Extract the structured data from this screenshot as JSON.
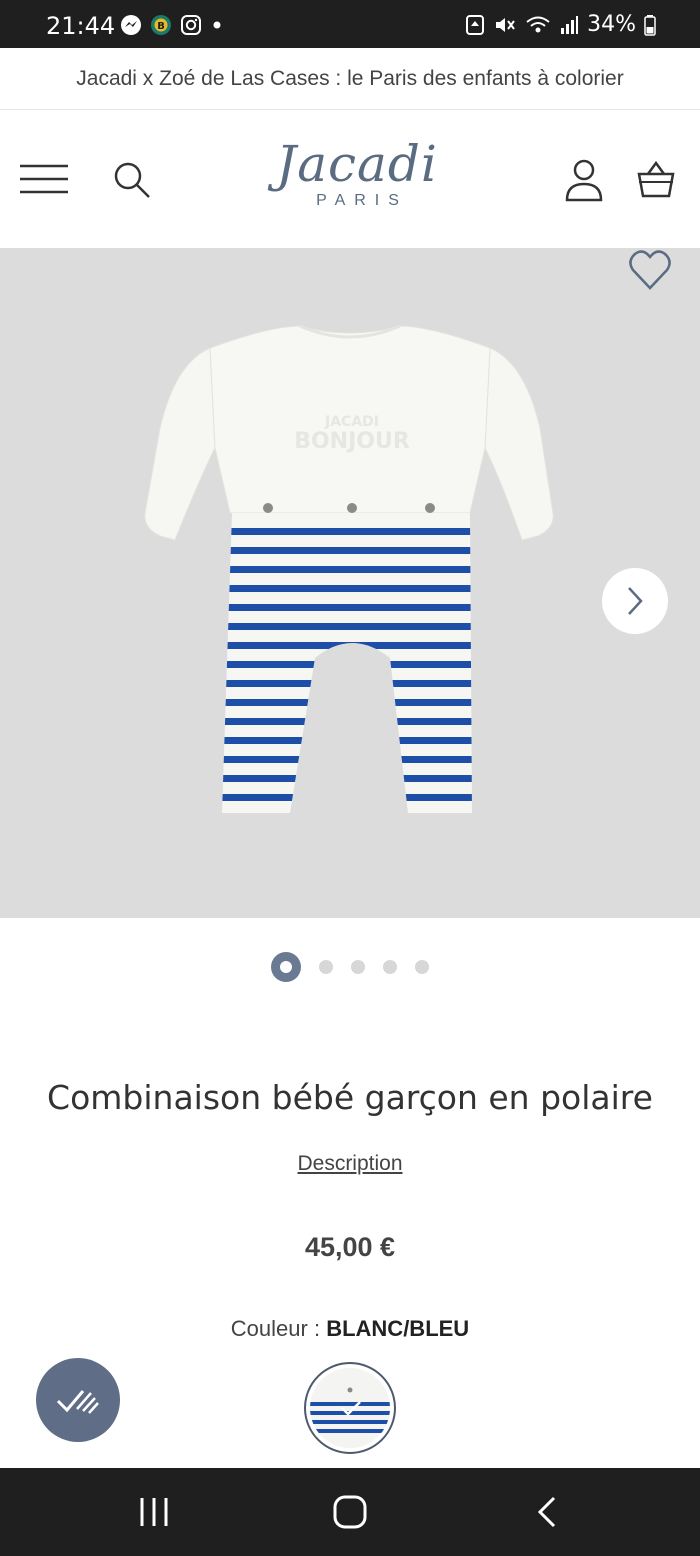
{
  "status_bar": {
    "time": "21:44",
    "battery": "34%",
    "left_icons": [
      "messenger-icon",
      "app-badge-icon",
      "instagram-icon",
      "dot-icon"
    ],
    "right_icons": [
      "recycle-icon",
      "mute-icon",
      "wifi-icon",
      "signal-icon",
      "battery-icon"
    ]
  },
  "promo": {
    "text": "Jacadi x Zoé de Las Cases : le Paris des enfants à colorier"
  },
  "header": {
    "logo_script": "Jacadi",
    "logo_sub": "PARIS",
    "brand_color": "#5a6b82"
  },
  "gallery": {
    "background": "#dcdcdd",
    "embroidery_line1": "JACADI",
    "embroidery_line2": "BONJOUR",
    "total_images": 5,
    "active_index": 0
  },
  "product": {
    "title": "Combinaison bébé garçon en polaire",
    "description_link": "Description",
    "price": "45,00 €",
    "color_label": "Couleur :",
    "color_value": "BLANC/BLEU"
  },
  "colors": {
    "accent": "#5f6e86",
    "stripe_blue": "#1e4fa8"
  }
}
